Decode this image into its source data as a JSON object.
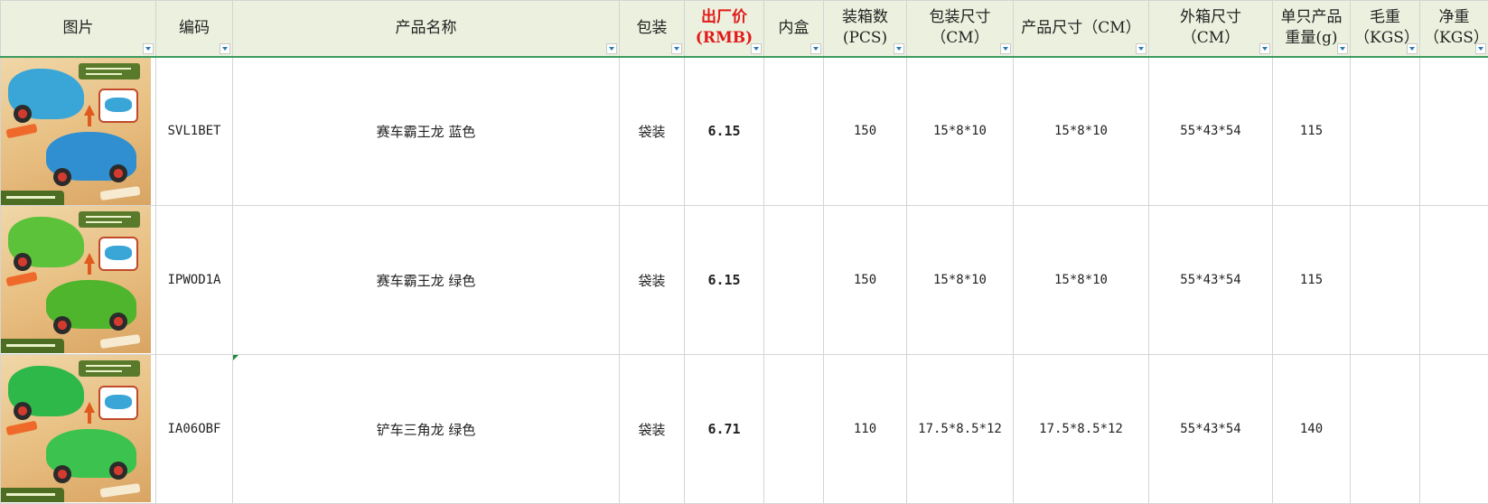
{
  "columns": [
    {
      "key": "image",
      "label": "图片"
    },
    {
      "key": "code",
      "label": "编码"
    },
    {
      "key": "name",
      "label": "产品名称"
    },
    {
      "key": "packaging",
      "label": "包装"
    },
    {
      "key": "price",
      "label": "出厂价\n(RMB)",
      "highlight": true
    },
    {
      "key": "inner_box",
      "label": "内盒"
    },
    {
      "key": "qty",
      "label": "装箱数\n(PCS)"
    },
    {
      "key": "pack_size",
      "label": "包装尺寸\n（CM）"
    },
    {
      "key": "product_size",
      "label": "产品尺寸（CM）"
    },
    {
      "key": "carton_size",
      "label": "外箱尺寸\n（CM）"
    },
    {
      "key": "unit_weight",
      "label": "单只产品\n重量(g)"
    },
    {
      "key": "gross_weight",
      "label": "毛重\n（KGS）"
    },
    {
      "key": "net_weight",
      "label": "净重\n（KGS）"
    }
  ],
  "rows": [
    {
      "image": {
        "icon": "blue-dinosaur-race-car-photo",
        "body_color": "#3aa6d8",
        "accent": "#2b2b2b"
      },
      "code": "SVL1BET",
      "name": "赛车霸王龙 蓝色",
      "packaging": "袋装",
      "price": "6.15",
      "inner_box": "",
      "qty": "150",
      "pack_size": "15*8*10",
      "product_size": "15*8*10",
      "carton_size": "55*43*54",
      "unit_weight": "115",
      "gross_weight": "",
      "net_weight": ""
    },
    {
      "image": {
        "icon": "green-dinosaur-race-car-photo",
        "body_color": "#5cc23a",
        "accent": "#3a3a3a"
      },
      "code": "IPWOD1A",
      "name": "赛车霸王龙 绿色",
      "packaging": "袋装",
      "price": "6.15",
      "inner_box": "",
      "qty": "150",
      "pack_size": "15*8*10",
      "product_size": "15*8*10",
      "carton_size": "55*43*54",
      "unit_weight": "115",
      "gross_weight": "",
      "net_weight": ""
    },
    {
      "image": {
        "icon": "green-triceratops-bulldozer-photo",
        "body_color": "#2fb84a",
        "accent": "#2a2a2a"
      },
      "code": "IA06OBF",
      "name": "铲车三角龙 绿色",
      "packaging": "袋装",
      "price": "6.71",
      "inner_box": "",
      "qty": "110",
      "pack_size": "17.5*8.5*12",
      "product_size": "17.5*8.5*12",
      "carton_size": "55*43*54",
      "unit_weight": "140",
      "gross_weight": "",
      "net_weight": ""
    }
  ],
  "colors": {
    "header_bg": "#ebf1de",
    "header_border": "#3c9b5e",
    "price_header": "#e21a1a",
    "gridline": "#d4d4d4"
  }
}
